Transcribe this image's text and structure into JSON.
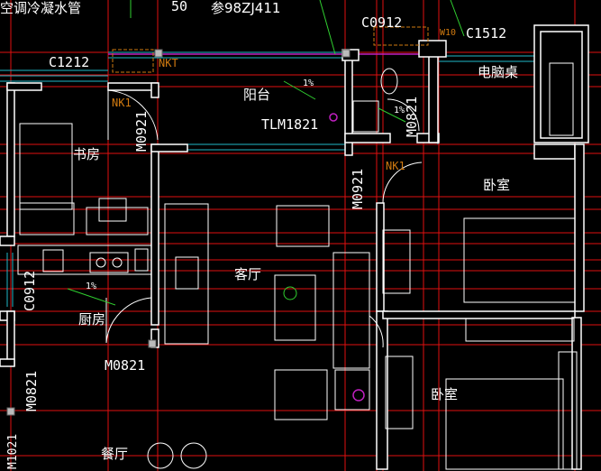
{
  "labels": {
    "top_left_note": "空调冷凝水管",
    "top_ref": "参98ZJ411",
    "top_circle": "50",
    "c0912_top": "C0912",
    "c1512": "C1512",
    "c1212": "C1212",
    "nkt_top": "NKT",
    "nk1_left": "NK1",
    "nk1_mid": "NK1",
    "balcony": "阳台",
    "tlm1821": "TLM1821",
    "computer_desk": "电脑桌",
    "study": "书房",
    "m0921_left": "M0921",
    "m0921_mid": "M0921",
    "m0821_bath": "M0821",
    "bedroom_1": "卧室",
    "living_room": "客厅",
    "c0912_left": "C0912",
    "kitchen": "厨房",
    "m0821_bottom": "M0821",
    "bedroom_2": "卧室",
    "m0821_left": "M0821",
    "m1021": "M1021",
    "dining": "餐厅",
    "slope_1": "1%",
    "slope_2": "1%",
    "slope_3": "1%",
    "w_note": "W10"
  },
  "colors": {
    "background": "#000000",
    "wall": "#ffffff",
    "axis": "#e01010",
    "window": "#1fb8c8",
    "annotation": "#d07a10",
    "furniture": "#ffffff",
    "dimension": "#30d030",
    "pipe": "#c020c0"
  }
}
